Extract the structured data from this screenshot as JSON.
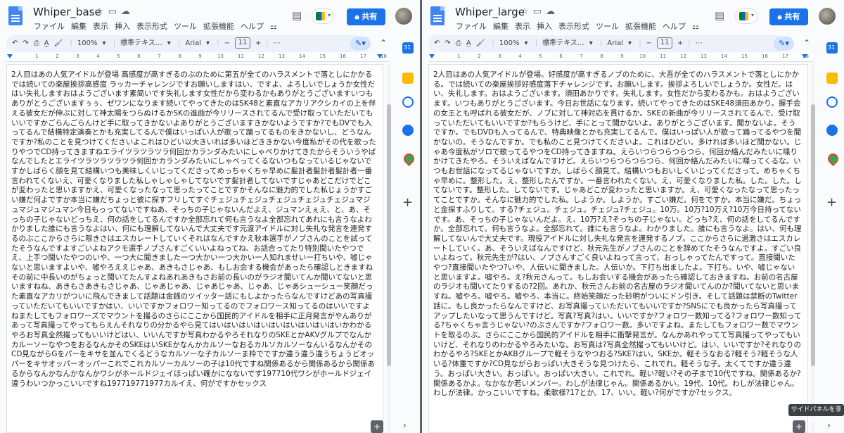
{
  "colors": {
    "accent": "#1a73e8",
    "window_bg": "#f9fbfd"
  },
  "menu": [
    "ファイル",
    "編集",
    "表示",
    "挿入",
    "表示形式",
    "ツール",
    "拡張機能",
    "ヘルプ",
    " "
  ],
  "share_label": "共有",
  "share_icon": "lock-icon",
  "toolbar": {
    "undo_icon": "undo-icon",
    "redo_icon": "redo-icon",
    "print_icon": "print-icon",
    "spell_icon": "spellcheck-icon",
    "paint_icon": "paint-format-icon",
    "zoom": "100%",
    "style": "標準テキス…",
    "font": "Arial",
    "minus": "−",
    "font_size": "11",
    "plus": "+",
    "more": "⋯",
    "edit_mode_icon": "pencil-icon"
  },
  "ruler_ticks": [
    "",
    "1",
    "2",
    "3",
    "4",
    "5",
    "6",
    "7",
    "8",
    "9",
    "10",
    "11",
    "12",
    "13",
    "14",
    "15",
    "16",
    "17",
    "18"
  ],
  "side_panel": {
    "items": [
      "calendar-icon",
      "keep-icon",
      "tasks-icon",
      "contacts-icon",
      "maps-icon"
    ],
    "add": "+",
    "collapse": "›"
  },
  "tooltip": "サイドパネルを非表示",
  "windows": [
    {
      "title": "Whiper_base",
      "text": "2人目はあの人気アイドルが登場 高感度が高すぎるのぶのために第五が全てのハラスメントで落としにかかるでは続いての楽屋挨拶高感度 ラッカーチャレンジですお願いしますはい、ですよ、よろしいでしょうか女性だはい失礼しますおはようございます素简いです失礼します女性だから変わるかもありがとうございますいつもありがとうございますぅぅ、ゼワンになります続いてやってきたのはSK48と素直なアカリアクシカイの上を伴える彼女だが伸ぶに対して神太陽をつらぬけるかSKの進曲が今リリースされてるんで受け取っていただいてもいいですかごらんごらんけど手に取ってきかないよありがとうございますきかないようですか?でもDVでも入ってるんで結構特定演奏とかも充実してるんで僕はいっぱい人が歌って踊ってるものをきかないし、どうなんですか?私のことを見つけてくださいよこれはひどい以大きいれば多いほどききかない今度私がその代を歌ったりやつでCD持ってきますねエライツラツラツラ何回かカランダみたいにしゃべりかけてきたからそういうやばなんでしたとエライツラツラツラツラ何回かカランダみたいにしゃべってくるないつもなっているじゃないですかしばらく顔を見て結構いつも美味しくいじってくださってめっちゃくちゃ早めに髪計者髪計者髪計者一番言われてくないえ、可愛くなりました私しゃしゃしゃしてないです髪計者してないですじゃあどこだけでどこが変わったと思いますかえ、可愛くなったなって思ったってことですかそんなに魅力的でした私じょうかすごい嫌だ何よですか本当に嫌だちょっと彼に探すフリしてすぐチェジュチェジュチェジュチェジュチェジュマジュマジュマジュマン今日もっってないですねあ、そっちの子じゃないんだよえ、ジュマンえぇえ、と、あ、そっちの子じゃないどっちえ、何の話をしてるんですか全部忘れて何も言うなよ全部忘れてあれにも言うなよわかりました誰にも言うなよはい、何にも理解してないんで大丈夫です元渡アイドルに対し失礼な発言を連発するのぶここからさらに限きさはエスカレートしていくそれはなんですかえ秋本選手がノブさんのことを試ってたそうなんですよすごいよねアクモ選手ノブさんすごくいいよねってね、お話合ってたり特別聞いたやつでえ、上手つ聞いたやつのいや、一つ大に聞きました一つ大かい一つ大かい一人知れませい一打ちいや、嘘じゃないと思いますよいや、嘘やろええじゃあ、あきもさじゃあ、もしお会する機会があったら確認しときますねその前に中長いのがちょっと聞いてたんすよねあれあきもさお前の長いのがラジオ聞いてんか聞いてないと思いますねね、あきもさあきもさじゃあ、じゃあじゃあ、じゃあじゃあ、じゃあ、じゃあシューシュー笑顔だった素直なアカリがついに飛んできまして話題は金銭のツイッター話にもしよかったらなんですけどあの写真撮っていただいてもいいですかはい、いいですかフォロワー知ってるのでフォロワース知ってるのはいいですよねまたしてもフォロワーズでマウントを撮るのさらにここから国民的アイドルを相手に正月発言がやんありがあって写真撮ってやってもらえんそれなりの分かるやら見てはいはいはいはいはいはいはいはいはいかわかるやろお写真全然撮ってもいいけどはい、いいんですか写真わかるやろそれなりのSKEとかAKVグルプでなんかカルーソーなやつをおるなんかそのSKEはいSKEかなんかカルソーなおるカルソカルソーなんいるなんかそのCD見ながらGをパーをキサを並んでくるどうなカルソーな子カルソーま枠でですか違う違う違うちょうどオッパーをキサオッパーオッパーこれでこれカルソーカルソーの子は10代ですね関係あるから関係あるから関係あるからなんかなんかなんかワシがホールドジェイほっぱい確かになないです197710代ワシがホールドジェイ違うわいつかっこいいですね197719771977カルイえ、何がですかセックス"
    },
    {
      "title": "Whiper_large",
      "text": "2人目はあの人気アイドルが登場。好感度が高すぎるノブのために、大吾が全てのハラスメントで落としにかかる。では続いての楽屋挨拶好感度落下チャレンジです。お願いします。挨拶よろしいでしょうか。女性だ。はい、失礼します。おはようございます。須田あかりです。失礼します。女性だから変わるかも。おはようございます。いつもありがとうございます。今日お世話になります。続いてやってきたのはSKE48須田あかり。握手会の女王とも呼ばれる彼女だが、ノブに対して神対応を貫けるか。SKEの新曲が今リリースされてるんで、受け取っていただいてもいいですか?もらうけど、手にとって聞かないよ。ありがとうございます。聞かないよ。そうですか。でもDVDも入ってるんで、特典映像とかも充実してるんで。僕はいっぱい人が歌って踊ってるやつを聞かないの。そうなんですか。でも私のこと見つけてくださいよ。これはひどい。多ければ多いほど聞かない。じゃあ今度私がソロで歌ってるやつをCD持ってきますね。えらいつらつらつらつら、何回か絡んだみたいに喋りかけてきたやろ。そういえばなんですけど。えらいつらつらつらつら、何回か絡んだみたいに喋ってくるな。いつもお世話になってるじゃないですか。しばらく顔見て。結構いつもおいしくいじってくださって。めちゃくちゃ早めに。整形した。え、整形したんですか。一番言われたくない。え、可愛くなりました私。した。した。してないです。整形した。してないです。じゃあどこが変わったと思いますか。え、可愛くなったなって思ったってことですか。そんなに魅力的でした私。しようか。しようか。すごい嫌だ。何をですか。本当に嫌だ。ちょっと金探すふりして。する?チェジュ。チェジュ。チェジュ?チェジュ。10万。10万?10万え?10万今日持ってないです。あ、そっちの子じゃないんだよ。え、10万?え?そっちの子じゃない。どっち?え、何の話をしてるんですか。全部忘れて。何も言うなよ。全部忘れて。誰にも言うなよ。わかりました。誰にも言うなよ。はい、何も理解してないんで大丈夫です。現役アイドルに対し失礼な発言を連発するノブ。ここからさらに過激さはエスカレートしていく。あ、そういえばなんですけど、秋元先生がノブさんのことを辞めてたそうなんですよ。すごい良いよねって。秋元先生が?はい、ノブさんすごく良いよねって言って、おっしゃってたんですって。直接聞いたやつ?直接聞いたやつ?いや、人伝いに聞きました。人伝いか。下打ち出ましたよ。下打ち。いや、嘘じゃないと思いますよ。嘘やろ。え?秋元さんって。もしお会いする機会があったら確認しておきますね。お前の名古屋のラジオも聞いてたりするの?2回。あれか、秋元さんお前の名古屋のラジオ聞いてんのか?聞いてないと思いますね。嘘やろ。嘘やろ。嘘やろ、本当に。終始笑顔だった砂明がついにドン引き。そして話題は禁断のTwitter話に。もし良かったらなんですけど、お写真撮っていただいてもいいですか?SNSにでも良かったら写真撮ってアップしたいなって思うんですけど。写真?写真?はい。いいですか?フォロワー数知ってる?フォロワー数知ってる?ちゃくちゃ言うじゃない?のぶさんですか?フォロワー数。多いですよね。またしてもフォロワー数でマウントを取るのぶ。さらにここから国民的アイドルを相手に衝撃発言が。なんかあれやってて写真撮ってやってもいいけど、それなりのわかるやろみたいな。お写真は?写真全然撮ってもいいけど。はい、いいですか?それなりのわかるやろ?SKEとかAKBグループで軽そうなやつおる?SKE?はい。SKEか。軽そうなおる?軽そう?軽そうな人いる?体重ですか?CD見ながらおっぱい大きそうな見つけたら、これでれ。軽そうな子。太くてですか違う違う。おっぱい大きい。おっぱい。おっぱい大きい。これでれ。軽い?軽い?その子まで10代ですね。関係あるか?関係あるかよ。なかなか若いメンバー。わしが法律じゃん。関係あるかい。19代、10代。わしが法律じゃん。わしが法律。かっこいいですね。柔軟様?17とか。17、いい。軽い?何がですか?セックス。"
    }
  ]
}
